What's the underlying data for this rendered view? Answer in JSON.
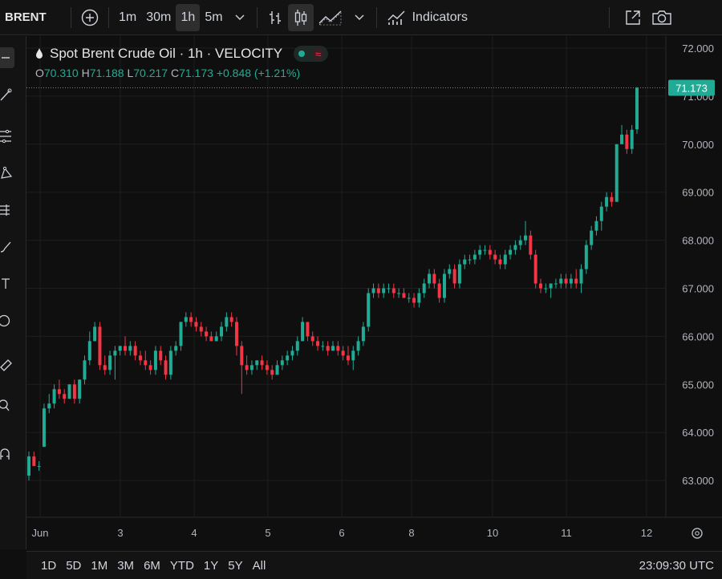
{
  "toolbar": {
    "symbol": "BRENT",
    "intervals": [
      "1m",
      "30m",
      "1h",
      "5m"
    ],
    "active_interval": "1h",
    "indicators_label": "Indicators",
    "icons": [
      "add-symbol-icon",
      "chevron-down-icon",
      "bar-style-icon",
      "candle-style-icon",
      "area-style-icon",
      "indicators-icon",
      "fullscreen-icon",
      "camera-icon"
    ]
  },
  "legend": {
    "title": "Spot Brent Crude Oil · 1h · VELOCITY",
    "o_label": "O",
    "o": "70.310",
    "h_label": "H",
    "h": "71.188",
    "l_label": "L",
    "l": "70.217",
    "c_label": "C",
    "c": "71.173",
    "change": "+0.848 (+1.21%)"
  },
  "colors": {
    "up": "#22ab94",
    "down": "#f23645",
    "bg": "#0f0f0f",
    "grid": "#1e1e1e",
    "price_tag": "#22ab94"
  },
  "chart_data": {
    "type": "candlestick",
    "title": "Spot Brent Crude Oil · 1h · VELOCITY",
    "ylim": [
      62.5,
      72.6
    ],
    "y_ticks": [
      "72.000",
      "71.000",
      "70.000",
      "69.000",
      "68.000",
      "67.000",
      "66.000",
      "65.000",
      "64.000",
      "63.000"
    ],
    "x_ticks": [
      "Jun",
      "3",
      "4",
      "5",
      "6",
      "8",
      "10",
      "11",
      "12"
    ],
    "last_price": "71.173",
    "grid": true,
    "series": [
      {
        "values": [
          [
            63.1,
            63.6,
            63.0,
            63.5
          ],
          [
            63.5,
            63.6,
            63.3,
            63.3
          ],
          [
            63.3,
            63.4,
            63.2,
            63.3
          ],
          [
            63.7,
            64.6,
            63.7,
            64.5
          ],
          [
            64.5,
            64.8,
            64.4,
            64.6
          ],
          [
            64.6,
            65.0,
            64.5,
            64.9
          ],
          [
            64.9,
            65.1,
            64.7,
            64.8
          ],
          [
            64.8,
            64.9,
            64.6,
            64.7
          ],
          [
            64.7,
            65.0,
            64.7,
            65.0
          ],
          [
            65.0,
            65.1,
            64.6,
            64.7
          ],
          [
            64.7,
            65.1,
            64.6,
            65.1
          ],
          [
            65.1,
            65.6,
            65.0,
            65.5
          ],
          [
            65.5,
            66.1,
            65.4,
            65.9
          ],
          [
            65.9,
            66.3,
            65.9,
            66.2
          ],
          [
            66.2,
            66.3,
            65.3,
            65.4
          ],
          [
            65.4,
            65.6,
            65.2,
            65.3
          ],
          [
            65.3,
            65.7,
            65.2,
            65.6
          ],
          [
            65.6,
            65.8,
            65.1,
            65.7
          ],
          [
            65.7,
            65.8,
            65.6,
            65.8
          ],
          [
            65.8,
            66.0,
            65.6,
            65.7
          ],
          [
            65.7,
            65.9,
            65.6,
            65.8
          ],
          [
            65.8,
            65.9,
            65.5,
            65.6
          ],
          [
            65.6,
            65.7,
            65.4,
            65.5
          ],
          [
            65.5,
            65.7,
            65.3,
            65.4
          ],
          [
            65.4,
            65.5,
            65.2,
            65.3
          ],
          [
            65.3,
            65.8,
            65.2,
            65.7
          ],
          [
            65.7,
            65.8,
            65.4,
            65.5
          ],
          [
            65.5,
            65.6,
            65.1,
            65.2
          ],
          [
            65.2,
            65.8,
            65.1,
            65.7
          ],
          [
            65.7,
            65.9,
            65.6,
            65.8
          ],
          [
            65.8,
            66.3,
            65.7,
            66.3
          ],
          [
            66.3,
            66.5,
            66.2,
            66.4
          ],
          [
            66.4,
            66.5,
            66.2,
            66.3
          ],
          [
            66.3,
            66.4,
            66.1,
            66.2
          ],
          [
            66.2,
            66.3,
            66.0,
            66.1
          ],
          [
            66.1,
            66.2,
            65.9,
            66.0
          ],
          [
            66.0,
            66.1,
            65.9,
            65.9
          ],
          [
            65.9,
            66.1,
            65.9,
            66.0
          ],
          [
            66.0,
            66.3,
            65.9,
            66.2
          ],
          [
            66.2,
            66.5,
            66.1,
            66.4
          ],
          [
            66.4,
            66.5,
            66.2,
            66.3
          ],
          [
            66.3,
            66.4,
            65.6,
            65.8
          ],
          [
            65.8,
            65.9,
            64.8,
            65.4
          ],
          [
            65.4,
            65.6,
            65.2,
            65.3
          ],
          [
            65.3,
            65.5,
            65.2,
            65.4
          ],
          [
            65.4,
            65.5,
            65.3,
            65.5
          ],
          [
            65.5,
            65.6,
            65.3,
            65.4
          ],
          [
            65.4,
            65.5,
            65.2,
            65.3
          ],
          [
            65.3,
            65.4,
            65.1,
            65.2
          ],
          [
            65.2,
            65.5,
            65.2,
            65.4
          ],
          [
            65.4,
            65.6,
            65.3,
            65.5
          ],
          [
            65.5,
            65.7,
            65.4,
            65.6
          ],
          [
            65.6,
            65.8,
            65.5,
            65.7
          ],
          [
            65.7,
            66.0,
            65.6,
            65.9
          ],
          [
            65.9,
            66.4,
            65.9,
            66.3
          ],
          [
            66.3,
            66.3,
            65.9,
            66.0
          ],
          [
            66.0,
            66.1,
            65.8,
            65.9
          ],
          [
            65.9,
            66.0,
            65.7,
            65.8
          ],
          [
            65.8,
            65.9,
            65.7,
            65.8
          ],
          [
            65.8,
            65.9,
            65.6,
            65.7
          ],
          [
            65.7,
            65.9,
            65.7,
            65.8
          ],
          [
            65.8,
            65.9,
            65.6,
            65.7
          ],
          [
            65.7,
            65.8,
            65.5,
            65.6
          ],
          [
            65.6,
            65.8,
            65.4,
            65.5
          ],
          [
            65.5,
            65.8,
            65.3,
            65.7
          ],
          [
            65.7,
            66.0,
            65.6,
            65.9
          ],
          [
            65.9,
            66.3,
            65.8,
            66.2
          ],
          [
            66.2,
            67.0,
            66.1,
            66.9
          ],
          [
            66.9,
            67.1,
            66.8,
            67.0
          ],
          [
            67.0,
            67.1,
            66.8,
            66.9
          ],
          [
            66.9,
            67.1,
            66.8,
            67.0
          ],
          [
            67.0,
            67.1,
            66.9,
            67.0
          ],
          [
            67.0,
            67.1,
            66.8,
            66.9
          ],
          [
            66.9,
            67.0,
            66.8,
            66.9
          ],
          [
            66.9,
            67.0,
            66.8,
            66.8
          ],
          [
            66.8,
            66.9,
            66.7,
            66.8
          ],
          [
            66.8,
            66.9,
            66.6,
            66.7
          ],
          [
            66.7,
            67.0,
            66.6,
            66.9
          ],
          [
            66.9,
            67.2,
            66.8,
            67.1
          ],
          [
            67.1,
            67.4,
            67.0,
            67.3
          ],
          [
            67.3,
            67.4,
            67.0,
            67.1
          ],
          [
            67.1,
            67.2,
            66.7,
            66.8
          ],
          [
            66.8,
            67.4,
            66.7,
            67.3
          ],
          [
            67.3,
            67.5,
            67.2,
            67.4
          ],
          [
            67.4,
            67.5,
            67.0,
            67.1
          ],
          [
            67.1,
            67.6,
            67.0,
            67.5
          ],
          [
            67.5,
            67.7,
            67.4,
            67.6
          ],
          [
            67.6,
            67.7,
            67.5,
            67.6
          ],
          [
            67.6,
            67.8,
            67.5,
            67.7
          ],
          [
            67.7,
            67.9,
            67.6,
            67.8
          ],
          [
            67.8,
            67.9,
            67.7,
            67.8
          ],
          [
            67.8,
            67.9,
            67.6,
            67.7
          ],
          [
            67.7,
            67.8,
            67.5,
            67.6
          ],
          [
            67.6,
            67.7,
            67.4,
            67.5
          ],
          [
            67.5,
            67.8,
            67.4,
            67.7
          ],
          [
            67.7,
            67.9,
            67.6,
            67.8
          ],
          [
            67.8,
            68.0,
            67.7,
            67.9
          ],
          [
            67.9,
            68.1,
            67.8,
            68.0
          ],
          [
            68.0,
            68.4,
            67.9,
            68.1
          ],
          [
            68.1,
            68.2,
            67.6,
            67.7
          ],
          [
            67.7,
            67.8,
            67.0,
            67.1
          ],
          [
            67.1,
            67.2,
            66.9,
            67.0
          ],
          [
            67.0,
            67.1,
            66.9,
            67.0
          ],
          [
            67.0,
            67.1,
            66.8,
            67.1
          ],
          [
            67.1,
            67.2,
            67.0,
            67.1
          ],
          [
            67.1,
            67.3,
            67.0,
            67.2
          ],
          [
            67.2,
            67.3,
            67.0,
            67.1
          ],
          [
            67.1,
            67.3,
            67.0,
            67.2
          ],
          [
            67.2,
            67.4,
            67.0,
            67.1
          ],
          [
            67.1,
            67.5,
            66.9,
            67.4
          ],
          [
            67.4,
            68.0,
            67.3,
            67.9
          ],
          [
            67.9,
            68.3,
            67.8,
            68.2
          ],
          [
            68.2,
            68.5,
            68.1,
            68.4
          ],
          [
            68.4,
            68.8,
            68.2,
            68.7
          ],
          [
            68.7,
            69.0,
            68.6,
            68.9
          ],
          [
            68.9,
            69.0,
            68.7,
            68.8
          ],
          [
            68.8,
            70.0,
            68.8,
            70.0
          ],
          [
            70.0,
            70.4,
            70.0,
            70.2
          ],
          [
            70.2,
            70.3,
            69.8,
            69.9
          ],
          [
            69.9,
            70.4,
            69.8,
            70.3
          ],
          [
            70.31,
            71.188,
            70.217,
            71.173
          ]
        ]
      }
    ]
  },
  "bottom": {
    "ranges": [
      "1D",
      "5D",
      "1M",
      "3M",
      "6M",
      "YTD",
      "1Y",
      "5Y",
      "All"
    ],
    "time": "23:09:30 UTC"
  }
}
